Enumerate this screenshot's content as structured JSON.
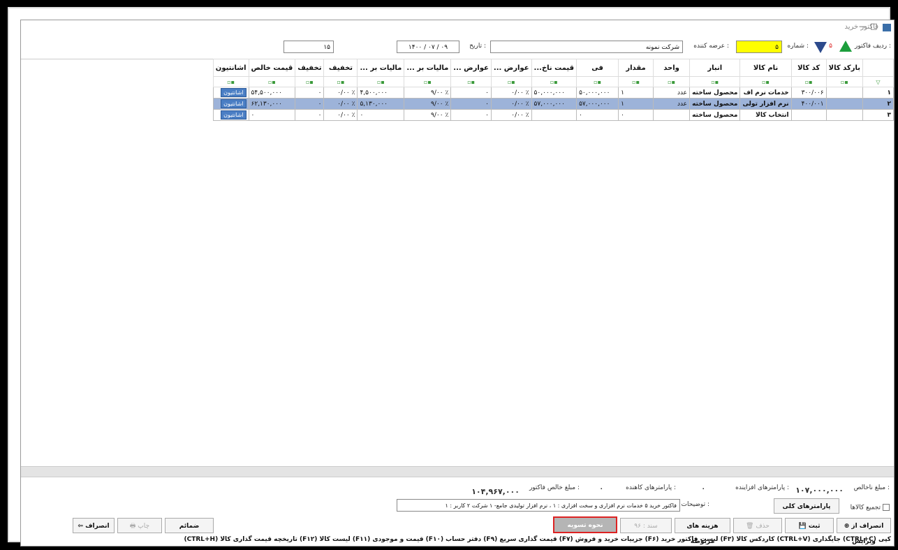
{
  "window": {
    "title": "فاکتور خرید",
    "controls": {
      "minimize": "—",
      "maximize": "□",
      "close": "✕"
    }
  },
  "header": {
    "row_label": "ردیف فاکتور :",
    "number_label": "شماره :",
    "number_value": "۵",
    "row_value": "۵",
    "supplier_label": "عرضه کننده :",
    "company_value": "شرکت نمونه",
    "date_label": "تاریخ :",
    "date_value": "۱۴۰۰ / ۰۷ / ۰۹",
    "right_field_value": "۱۵",
    "accent_color": "#ffff00"
  },
  "table": {
    "columns": [
      "بارکد کالا",
      "کد کالا",
      "نام کالا",
      "انبار",
      "واحد",
      "مقدار",
      "فی",
      "قیمت ناخ...",
      "عوارض ...",
      "عوارض ...",
      "مالیات بر ...",
      "مالیات بر ...",
      "تخفیف",
      "تخفیف",
      "قیمت خالص",
      "اشانتیون"
    ],
    "rows": [
      {
        "idx": "۱",
        "barcode": "",
        "code": "۳۰۰/۰۰۶",
        "name": "خدمات نرم اف",
        "store": "محصول ساخته",
        "unit": "عدد",
        "qty": "۱",
        "price": "۵۰,۰۰۰,۰۰۰",
        "gross": "۵۰,۰۰۰,۰۰۰",
        "duty_pct": "٪ ۰/۰۰",
        "duty": "۰",
        "tax_pct": "٪ ۹/۰۰",
        "tax": "۴,۵۰۰,۰۰۰",
        "disc_pct": "٪ ۰/۰۰",
        "disc": "۰",
        "net": "۵۴,۵۰۰,۰۰۰",
        "gift": "اشانتیون"
      },
      {
        "idx": "۲",
        "barcode": "",
        "code": "۴۰۰/۰۰۱",
        "name": "نرم افزار تولی",
        "store": "محصول ساخته",
        "unit": "عدد",
        "qty": "۱",
        "price": "۵۷,۰۰۰,۰۰۰",
        "gross": "۵۷,۰۰۰,۰۰۰",
        "duty_pct": "٪ ۰/۰۰",
        "duty": "۰",
        "tax_pct": "٪ ۹/۰۰",
        "tax": "۵,۱۳۰,۰۰۰",
        "disc_pct": "٪ ۰/۰۰",
        "disc": "۰",
        "net": "۶۲,۱۳۰,۰۰۰",
        "gift": "اشانتیون"
      },
      {
        "idx": "۳",
        "barcode": "",
        "code": "",
        "name": "انتخاب کالا",
        "store": "محصول ساخته",
        "unit": "",
        "qty": "۰",
        "price": "۰",
        "gross": "",
        "duty_pct": "٪ ۰/۰۰",
        "duty": "۰",
        "tax_pct": "٪ ۹/۰۰",
        "tax": "۰",
        "disc_pct": "٪ ۰/۰۰",
        "disc": "۰",
        "net": "۰",
        "gift": "اشانتیون"
      }
    ]
  },
  "footer": {
    "gross_label": "مبلغ ناخالص :",
    "gross_value": "۱۰۷,۰۰۰,۰۰۰",
    "add_params_label": "پارامترهای افزاینده :",
    "add_params_value": "۰",
    "sub_params_label": "پارامترهای کاهنده :",
    "sub_params_value": "۰",
    "net_label": "مبلغ خالص فاکتور :",
    "net_value": "۱۰۴,۹۶۷,۰۰۰",
    "merge_items_label": "تجمیع کالاها",
    "general_params": "پارامترهای کلی",
    "desc_label": "توضیحات :",
    "desc_value": "فاکتور خرید ۵ خدمات نرم افزاری و سخت افزاری : ۱ ، نرم افزار تولیدی جامع- ۱ شرکت ۲ کاربر : ۱",
    "btn_return": "انصراف از ویرایش",
    "btn_save": "ثبت",
    "btn_delete": "حذف",
    "btn_costs": "هزینه های مربوطه",
    "btn_doc": "سند : ۹۶",
    "btn_settle": "نحوه تسویه",
    "btn_attach": "ضمائم",
    "btn_print": "چاپ",
    "btn_cancel": "انصراف",
    "shortcuts": "کپی (CTRL+C) جایگذاری (CTRL+V) کاردکس کالا (F۳) لیست فاکتور خرید (F۶) جزییات خرید و فروش (F۷) قیمت گذاری سریع (F۹) دفتر حساب (F۱۰) قیمت و موجودی (F۱۱) لیست کالا (F۱۲) تاریخچه قیمت گذاری کالا (CTRL+H)"
  }
}
